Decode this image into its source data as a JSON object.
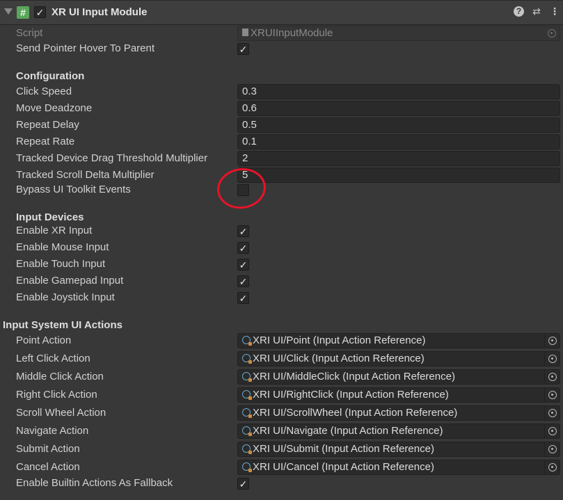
{
  "header": {
    "title": "XR UI Input Module",
    "check_glyph": "✓",
    "script_glyph": "#",
    "help_glyph": "?",
    "preset_glyph": "⇄",
    "menu_glyph": "⋮"
  },
  "checkmark": "✓",
  "script": {
    "label": "Script",
    "value": "XRUIInputModule"
  },
  "send_hover": {
    "label": "Send Pointer Hover To Parent",
    "checked": true
  },
  "configuration": {
    "title": "Configuration",
    "fields": [
      {
        "label": "Click Speed",
        "value": "0.3"
      },
      {
        "label": "Move Deadzone",
        "value": "0.6"
      },
      {
        "label": "Repeat Delay",
        "value": "0.5"
      },
      {
        "label": "Repeat Rate",
        "value": "0.1"
      },
      {
        "label": "Tracked Device Drag Threshold Multiplier",
        "value": "2"
      },
      {
        "label": "Tracked Scroll Delta Multiplier",
        "value": "5"
      }
    ],
    "bypass": {
      "label": "Bypass UI Toolkit Events",
      "checked": false
    }
  },
  "input_devices": {
    "title": "Input Devices",
    "items": [
      {
        "label": "Enable XR Input",
        "checked": true
      },
      {
        "label": "Enable Mouse Input",
        "checked": true
      },
      {
        "label": "Enable Touch Input",
        "checked": true
      },
      {
        "label": "Enable Gamepad Input",
        "checked": true
      },
      {
        "label": "Enable Joystick Input",
        "checked": true
      }
    ]
  },
  "actions": {
    "title": "Input System UI Actions",
    "items": [
      {
        "label": "Point Action",
        "value": "XRI UI/Point (Input Action Reference)"
      },
      {
        "label": "Left Click Action",
        "value": "XRI UI/Click (Input Action Reference)"
      },
      {
        "label": "Middle Click Action",
        "value": "XRI UI/MiddleClick (Input Action Reference)"
      },
      {
        "label": "Right Click Action",
        "value": "XRI UI/RightClick (Input Action Reference)"
      },
      {
        "label": "Scroll Wheel Action",
        "value": "XRI UI/ScrollWheel (Input Action Reference)"
      },
      {
        "label": "Navigate Action",
        "value": "XRI UI/Navigate (Input Action Reference)"
      },
      {
        "label": "Submit Action",
        "value": "XRI UI/Submit (Input Action Reference)"
      },
      {
        "label": "Cancel Action",
        "value": "XRI UI/Cancel (Input Action Reference)"
      }
    ],
    "fallback": {
      "label": "Enable Builtin Actions As Fallback",
      "checked": true
    }
  },
  "colors": {
    "background": "#383838",
    "field": "#2a2a2a",
    "annotation": "#e8132a"
  },
  "icons": {
    "script": "csharp-script-icon",
    "reference": "input-action-reference-icon",
    "picker": "object-picker-icon"
  }
}
